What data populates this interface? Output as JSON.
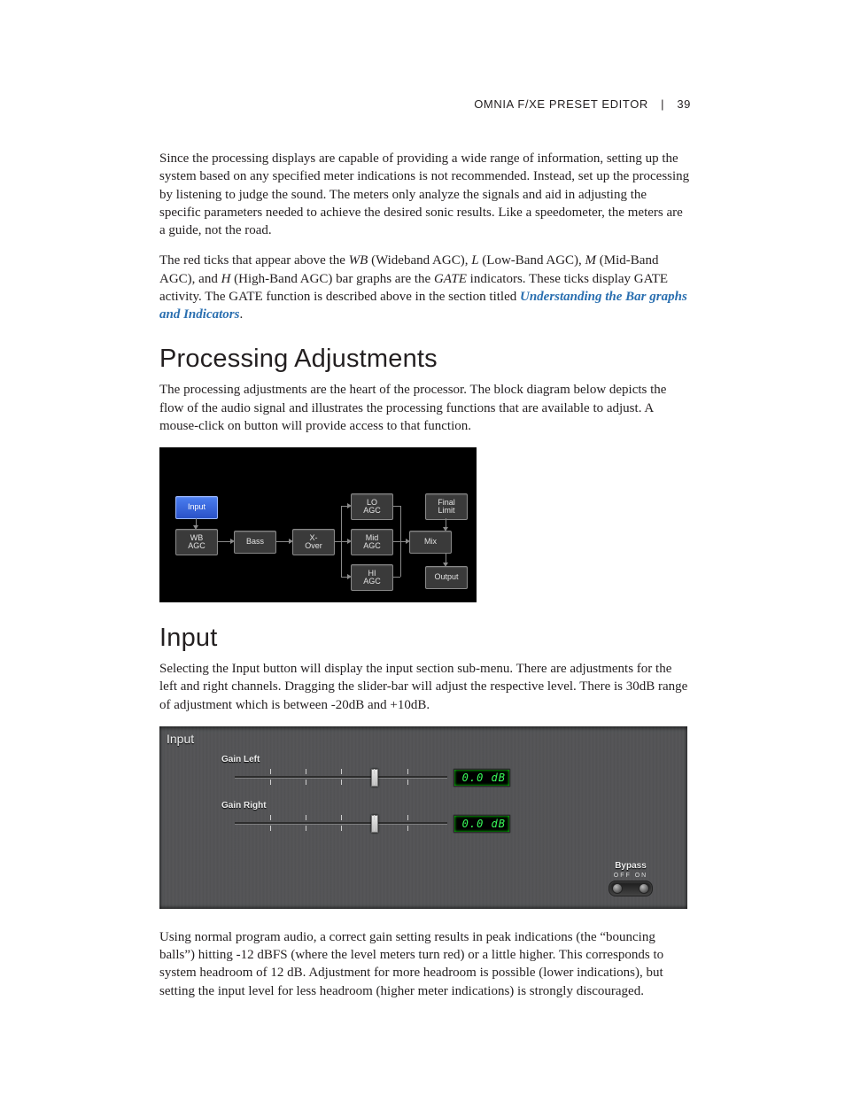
{
  "header": {
    "title": "OMNIA F/XE PRESET EDITOR",
    "page": "39"
  },
  "para1": "Since the processing displays are capable of providing a wide range of information, setting up the system based on any specified meter indications is not recommended. Instead, set up the processing by listening to judge the sound. The meters only analyze the signals and aid in adjusting the specific parameters needed to achieve the desired sonic results. Like a speedometer, the meters are a guide, not the road.",
  "para2": {
    "a": "The red ticks that appear above the ",
    "wb": "WB",
    "wb_paren": " (Wideband AGC), ",
    "l": "L",
    "l_paren": " (Low-Band AGC), ",
    "m": "M",
    "m_paren": " (Mid-Band AGC), and ",
    "h": "H",
    "h_paren": " (High-Band AGC) bar graphs are the ",
    "gate": "GATE",
    "tail": " indicators. These ticks display GATE activity. The GATE function is described above in the section titled ",
    "link": "Understanding the Bar graphs and Indicators",
    "period": "."
  },
  "h_proc": "Processing Adjustments",
  "para3": "The processing adjustments are the heart of the processor.  The block diagram below depicts the flow of the audio signal and illustrates the processing functions that are available to adjust. A mouse-click on button will provide access to that function.",
  "diagram": {
    "input": "Input",
    "wb_agc": "WB\nAGC",
    "bass": "Bass",
    "xover": "X-\nOver",
    "lo_agc": "LO\nAGC",
    "mid_agc": "Mid\nAGC",
    "hi_agc": "HI\nAGC",
    "mix": "Mix",
    "final": "Final\nLimit",
    "output": "Output"
  },
  "h_input": "Input",
  "para4": "Selecting the Input button will display the input section sub-menu. There are adjustments for the left and right channels. Dragging the slider-bar will adjust the respective level. There is 30dB range of adjustment which is between -20dB and +10dB.",
  "panel": {
    "title": "Input",
    "gain_left": "Gain Left",
    "gain_right": "Gain Right",
    "val_left": "0.0 dB",
    "val_right": "0.0 dB",
    "bypass": "Bypass",
    "off_on": "OFF  ON"
  },
  "para5": "Using normal program audio, a correct gain setting results in peak indications (the “bouncing balls”) hitting -12 dBFS (where the level meters turn red) or a little higher. This corresponds to system headroom of 12 dB. Adjustment for more headroom is possible (lower indications), but setting the input level for less headroom (higher meter indications) is strongly discouraged."
}
